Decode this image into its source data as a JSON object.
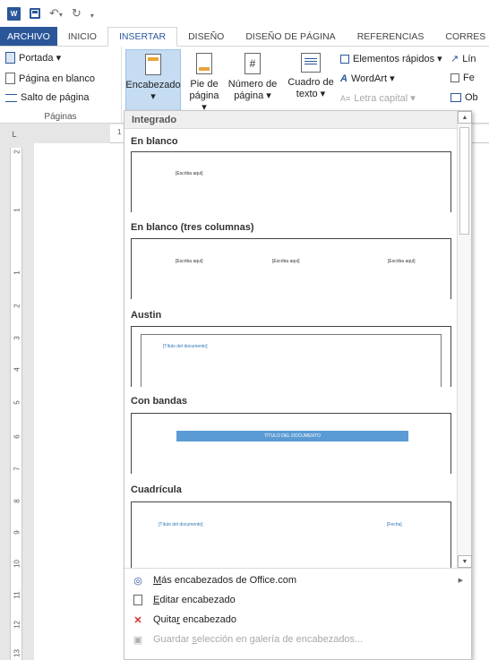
{
  "qat": {
    "word": "W",
    "undo": "↶",
    "undo_more": "▾",
    "redo": "↻",
    "customize": "▾"
  },
  "tabs": [
    "ARCHIVO",
    "INICIO",
    "INSERTAR",
    "DISEÑO",
    "DISEÑO DE PÁGINA",
    "REFERENCIAS",
    "CORRES"
  ],
  "ribbon": {
    "paginas": {
      "portada": "Portada ▾",
      "pagina_blanco": "Página en blanco",
      "salto": "Salto de página",
      "label": "Páginas"
    },
    "encabezado": {
      "line1": "Encabezado",
      "line2": "▾"
    },
    "pie": {
      "line1": "Pie de",
      "line2": "página ▾"
    },
    "numero": {
      "line1": "Número de",
      "line2": "página ▾"
    },
    "cuadro": {
      "line1": "Cuadro de",
      "line2": "texto ▾"
    },
    "elementos": "Elementos rápidos ▾",
    "wordart": "WordArt ▾",
    "letra": "Letra capital ▾",
    "right1": "Lín",
    "right2": "Fe",
    "right3": "Ob"
  },
  "ruler": {
    "corner": "L",
    "h_mark": "1",
    "v_ticks": [
      "2",
      "1",
      "1",
      "2",
      "3",
      "4",
      "5",
      "6",
      "7",
      "8",
      "9",
      "10",
      "11",
      "12",
      "13"
    ]
  },
  "dropdown": {
    "header": "Integrado",
    "galleries": [
      {
        "title": "En blanco",
        "placeholders": [
          "[Escriba aquí]"
        ]
      },
      {
        "title": "En blanco (tres columnas)",
        "placeholders": [
          "[Escriba aquí]",
          "[Escriba aquí]",
          "[Escriba aquí]"
        ]
      },
      {
        "title": "Austin",
        "placeholders": [
          "[Título del documento]"
        ]
      },
      {
        "title": "Con bandas",
        "placeholders": [
          "TÍTULO DEL DOCUMENTO"
        ]
      },
      {
        "title": "Cuadrícula",
        "placeholders": [
          "[Título del documento]",
          "[Fecha]"
        ]
      }
    ],
    "menu": [
      {
        "pre": "",
        "ul": "M",
        "post": "ás encabezados de Office.com",
        "has_arrow": true,
        "disabled": false
      },
      {
        "pre": "",
        "ul": "E",
        "post": "ditar encabezado",
        "has_arrow": false,
        "disabled": false
      },
      {
        "pre": "Quita",
        "ul": "r",
        "post": " encabezado",
        "has_arrow": false,
        "disabled": false
      },
      {
        "pre": "Guardar ",
        "ul": "s",
        "post": "elección en galería de encabezados...",
        "has_arrow": false,
        "disabled": true
      }
    ],
    "submenu_arrow": "▶",
    "scroll_up": "▲",
    "scroll_down": "▼"
  }
}
